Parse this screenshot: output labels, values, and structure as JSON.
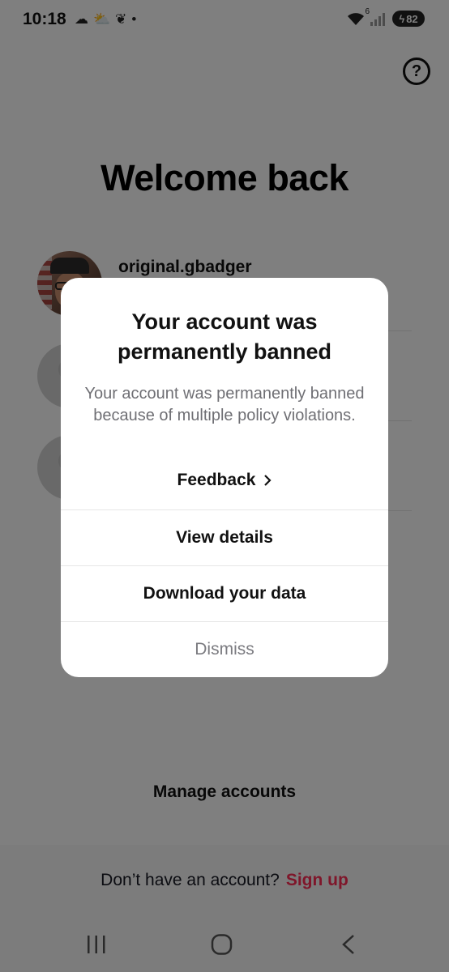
{
  "status_bar": {
    "time": "10:18",
    "left_icons": [
      "cloud-icon",
      "partly-sunny-icon",
      "leaf-icon",
      "dot-icon"
    ],
    "network_badge": "6",
    "battery": "82"
  },
  "header": {
    "title": "Welcome back",
    "help_icon": "?"
  },
  "accounts": [
    {
      "name": "original.gbadger",
      "avatar": "photo"
    },
    {
      "name": "",
      "avatar": "blank"
    },
    {
      "name": "",
      "avatar": "blank"
    }
  ],
  "modal": {
    "title": "Your account was permanently banned",
    "message": "Your account was permanently banned because of multiple policy violations.",
    "feedback_label": "Feedback",
    "actions": {
      "view_details": "View details",
      "download_data": "Download your data",
      "dismiss": "Dismiss"
    }
  },
  "footer": {
    "manage_accounts": "Manage accounts",
    "no_account_text": "Don’t have an account?",
    "signup_label": "Sign up"
  },
  "colors": {
    "accent": "#fe2c55",
    "scrim": "rgba(0,0,0,0.5)"
  },
  "nav_bar": {
    "icons": [
      "recent-apps-icon",
      "home-icon",
      "back-icon"
    ]
  }
}
